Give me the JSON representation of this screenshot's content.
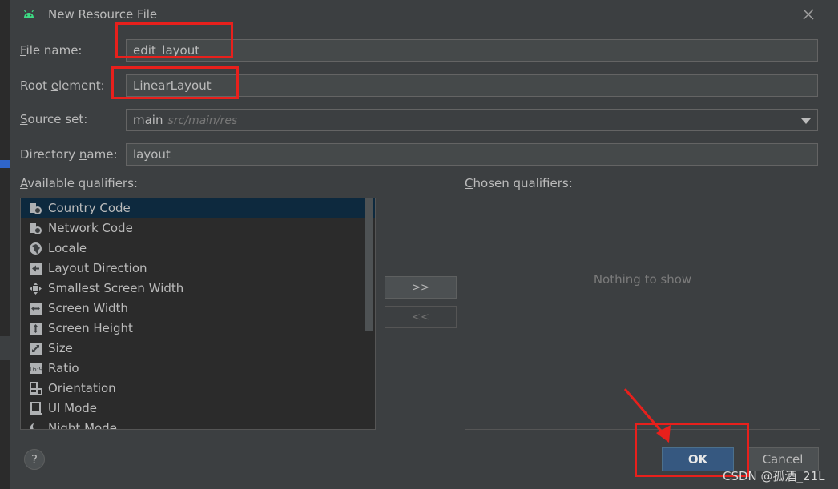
{
  "window": {
    "title": "New Resource File"
  },
  "form": {
    "file_name_label_prefix": "F",
    "file_name_label_rest": "ile name:",
    "file_name_value": "edit_layout",
    "root_element_label_prefix": "Root ",
    "root_element_label_u": "e",
    "root_element_label_rest": "lement:",
    "root_element_value": "LinearLayout",
    "source_set_label_prefix": "S",
    "source_set_label_rest": "ource set:",
    "source_set_value": "main",
    "source_set_hint": "src/main/res",
    "directory_label_prefix": "Directory ",
    "directory_label_u": "n",
    "directory_label_rest": "ame:",
    "directory_value": "layout"
  },
  "available": {
    "label_prefix": "A",
    "label_u": "v",
    "label_rest": "ailable qualifiers:",
    "items": [
      {
        "label": "Country Code",
        "icon": "country-code-icon"
      },
      {
        "label": "Network Code",
        "icon": "network-code-icon"
      },
      {
        "label": "Locale",
        "icon": "globe-icon"
      },
      {
        "label": "Layout Direction",
        "icon": "layout-direction-icon"
      },
      {
        "label": "Smallest Screen Width",
        "icon": "smallest-width-icon"
      },
      {
        "label": "Screen Width",
        "icon": "screen-width-icon"
      },
      {
        "label": "Screen Height",
        "icon": "screen-height-icon"
      },
      {
        "label": "Size",
        "icon": "size-icon"
      },
      {
        "label": "Ratio",
        "icon": "ratio-icon"
      },
      {
        "label": "Orientation",
        "icon": "orientation-icon"
      },
      {
        "label": "UI Mode",
        "icon": "ui-mode-icon"
      },
      {
        "label": "Night Mode",
        "icon": "night-mode-icon"
      }
    ]
  },
  "chosen": {
    "label_prefix": "C",
    "label_u": "h",
    "label_rest": "osen qualifiers:",
    "empty_text": "Nothing to show"
  },
  "buttons": {
    "add": ">>",
    "remove": "<<",
    "help": "?",
    "ok": "OK",
    "cancel": "Cancel"
  },
  "watermark": "CSDN @孤酒_21L",
  "colors": {
    "dialog_bg": "#3c3f41",
    "selection": "#0d293e",
    "primary_button": "#365880",
    "annotation_red": "#e8201c",
    "android_green": "#3ddc84"
  }
}
